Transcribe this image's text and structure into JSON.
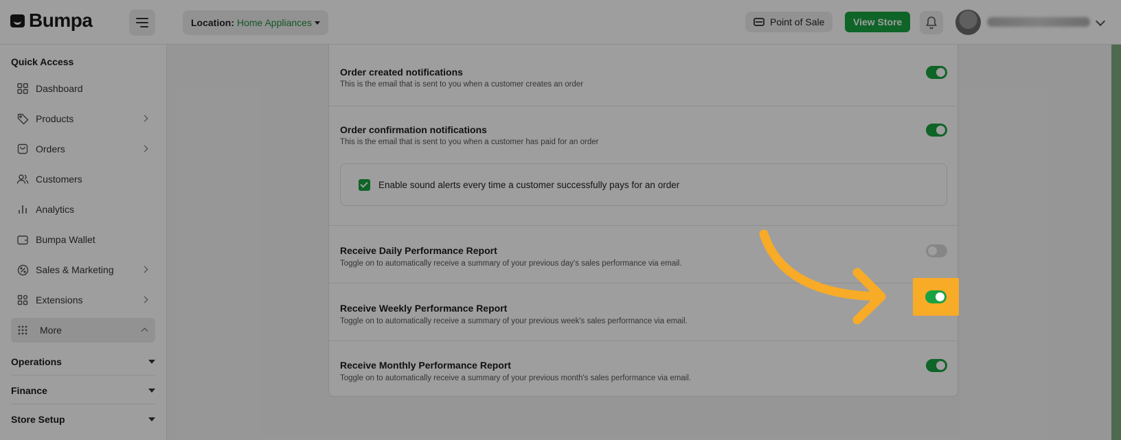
{
  "brand": {
    "name": "Bumpa"
  },
  "header": {
    "location_label": "Location:",
    "location_value": "Home Appliances",
    "pos_label": "Point of Sale",
    "view_store_label": "View Store"
  },
  "sidebar": {
    "quick_access_title": "Quick Access",
    "items": [
      {
        "label": "Dashboard",
        "icon": "grid-icon"
      },
      {
        "label": "Products",
        "icon": "tag-icon"
      },
      {
        "label": "Orders",
        "icon": "bag-icon"
      },
      {
        "label": "Customers",
        "icon": "users-icon"
      },
      {
        "label": "Analytics",
        "icon": "bar-chart-icon"
      },
      {
        "label": "Bumpa Wallet",
        "icon": "wallet-icon"
      },
      {
        "label": "Sales & Marketing",
        "icon": "percent-icon"
      },
      {
        "label": "Extensions",
        "icon": "puzzle-icon"
      },
      {
        "label": "More",
        "icon": "dots-grid-icon"
      }
    ],
    "groups": [
      {
        "label": "Operations"
      },
      {
        "label": "Finance"
      },
      {
        "label": "Store Setup"
      }
    ]
  },
  "settings": {
    "rows": [
      {
        "title": "Order created notifications",
        "description": "This is the email that is sent to you when a customer creates an order",
        "enabled": true
      },
      {
        "title": "Order confirmation notifications",
        "description": "This is the email that is sent to you when a customer has paid for an order",
        "enabled": true
      },
      {
        "title": "Receive Daily Performance Report",
        "description": "Toggle on to automatically receive a summary of your previous day's sales performance via email.",
        "enabled": false
      },
      {
        "title": "Receive Weekly Performance Report",
        "description": "Toggle on to automatically receive a summary of your previous week's sales performance via email.",
        "enabled": true
      },
      {
        "title": "Receive Monthly Performance Report",
        "description": "Toggle on to automatically receive a summary of your previous month's sales performance via email.",
        "enabled": true
      }
    ],
    "sound_alert": {
      "label": "Enable sound alerts every time a customer successfully pays for an order",
      "checked": true
    }
  },
  "colors": {
    "accent_green": "#19a241",
    "highlight_orange": "#f8ab27"
  }
}
